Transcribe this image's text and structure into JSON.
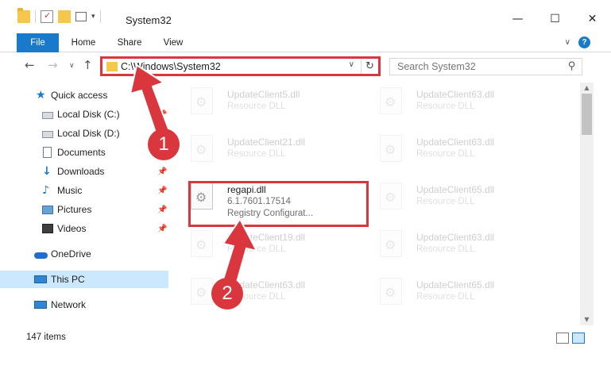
{
  "window": {
    "title": "System32"
  },
  "ribbon": {
    "tabs": [
      "File",
      "Home",
      "Share",
      "View"
    ]
  },
  "nav": {
    "address": "C:\\Windows\\System32",
    "search_placeholder": "Search System32"
  },
  "sidebar": {
    "items": [
      {
        "label": "Quick access",
        "icon": "star-icon"
      },
      {
        "label": "Local Disk (C:)",
        "icon": "drive-icon",
        "pinned": true
      },
      {
        "label": "Local Disk (D:)",
        "icon": "drive-icon"
      },
      {
        "label": "Documents",
        "icon": "documents-icon",
        "pinned": true
      },
      {
        "label": "Downloads",
        "icon": "downloads-icon",
        "pinned": true
      },
      {
        "label": "Music",
        "icon": "music-icon",
        "pinned": true
      },
      {
        "label": "Pictures",
        "icon": "pictures-icon",
        "pinned": true
      },
      {
        "label": "Videos",
        "icon": "videos-icon",
        "pinned": true
      },
      {
        "label": "OneDrive",
        "icon": "onedrive-icon"
      },
      {
        "label": "This PC",
        "icon": "pc-icon",
        "selected": true
      },
      {
        "label": "Network",
        "icon": "network-icon"
      }
    ]
  },
  "files": [
    {
      "name": "UpdateClient5.dll",
      "desc": "Resource DLL"
    },
    {
      "name": "UpdateClient63.dll",
      "desc": "Resource DLL"
    },
    {
      "name": "UpdateClient21.dll",
      "desc": "Resource DLL"
    },
    {
      "name": "UpdateClient63.dll",
      "desc": "Resource DLL"
    },
    {
      "name": "regapi.dll",
      "version": "6.1.7601.17514",
      "desc": "Registry Configurat..."
    },
    {
      "name": "UpdateClient65.dll",
      "desc": "Resource DLL"
    },
    {
      "name": "UpdateClient19.dll",
      "desc": "Resource DLL"
    },
    {
      "name": "UpdateClient63.dll",
      "desc": "Resource DLL"
    },
    {
      "name": "UpdateClient63.dll",
      "desc": "Resource DLL"
    },
    {
      "name": "UpdateClient65.dll",
      "desc": "Resource DLL"
    }
  ],
  "status": {
    "item_count": "147 items"
  },
  "annotations": {
    "step1": "1",
    "step2": "2"
  },
  "colors": {
    "accent": "#1979ca",
    "annotation": "#d9363e",
    "selected": "#cce8ff"
  }
}
